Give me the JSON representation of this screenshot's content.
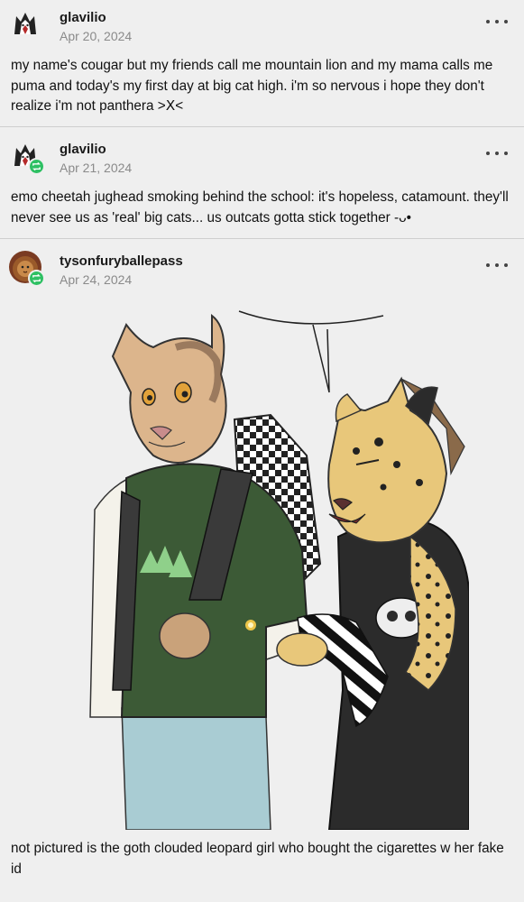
{
  "posts": [
    {
      "username": "glavilio",
      "date": "Apr 20, 2024",
      "text": "my name's cougar but my friends call me mountain lion and my mama calls me puma and today's my first day at big cat high. i'm so nervous i hope they don't realize i'm not panthera >ⵝ<",
      "avatar_icon": "husky-avatar-icon",
      "reblog": false
    },
    {
      "username": "glavilio",
      "date": "Apr 21, 2024",
      "text": "emo cheetah jughead smoking behind the school: it's hopeless, catamount. they'll never see us as 'real' big cats... us outcats gotta stick together -ᴗ•",
      "avatar_icon": "husky-avatar-icon",
      "reblog": true
    },
    {
      "username": "tysonfuryballepass",
      "date": "Apr 24, 2024",
      "text": "not pictured is the goth clouded leopard girl who bought the cigarettes w her fake id",
      "avatar_icon": "lion-avatar-icon",
      "reblog": true,
      "image": "cougar-and-cheetah-illustration"
    }
  ],
  "colors": {
    "background": "#efefef",
    "reblog_badge": "#2ec063",
    "date": "#8a8a8a"
  }
}
